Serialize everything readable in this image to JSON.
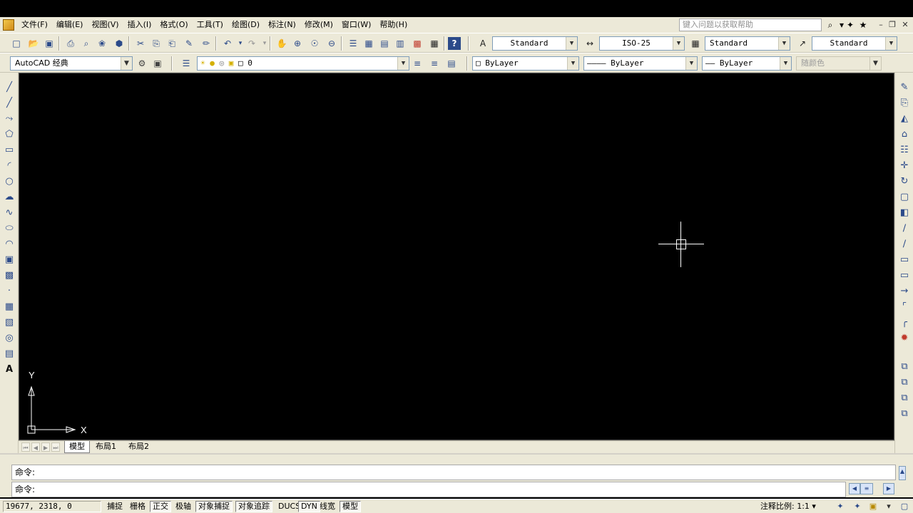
{
  "menubar": {
    "items": [
      "文件(F)",
      "编辑(E)",
      "视图(V)",
      "插入(I)",
      "格式(O)",
      "工具(T)",
      "绘图(D)",
      "标注(N)",
      "修改(M)",
      "窗口(W)",
      "帮助(H)"
    ],
    "help_placeholder": "键入问题以获取帮助"
  },
  "toolbar1": {
    "text_style": "Standard",
    "dim_style": "ISO-25",
    "table_style": "Standard",
    "multileader_style": "Standard"
  },
  "toolbar2": {
    "workspace": "AutoCAD 经典",
    "layer": "0",
    "color": "ByLayer",
    "linetype": "ByLayer",
    "lineweight": "ByLayer",
    "plotstyle": "随颜色"
  },
  "ucs": {
    "x_label": "X",
    "y_label": "Y"
  },
  "layout_tabs": [
    "模型",
    "布局1",
    "布局2"
  ],
  "command": {
    "line1": "命令:",
    "line2": "命令:"
  },
  "statusbar": {
    "coords": "19677, 2318, 0",
    "toggles": [
      {
        "label": "捕捉",
        "on": false
      },
      {
        "label": "栅格",
        "on": false
      },
      {
        "label": "正交",
        "on": true
      },
      {
        "label": "极轴",
        "on": false
      },
      {
        "label": "对象捕捉",
        "on": true
      },
      {
        "label": "对象追踪",
        "on": true
      },
      {
        "label": "DUCS",
        "on": false
      },
      {
        "label": "DYN",
        "on": true
      },
      {
        "label": "线宽",
        "on": false
      },
      {
        "label": "模型",
        "on": true
      }
    ],
    "annotation_scale_label": "注释比例:",
    "annotation_scale": "1:1"
  },
  "colors": {
    "chrome": "#ece9d8",
    "canvas": "#000000",
    "crosshair": "#ffffff"
  }
}
